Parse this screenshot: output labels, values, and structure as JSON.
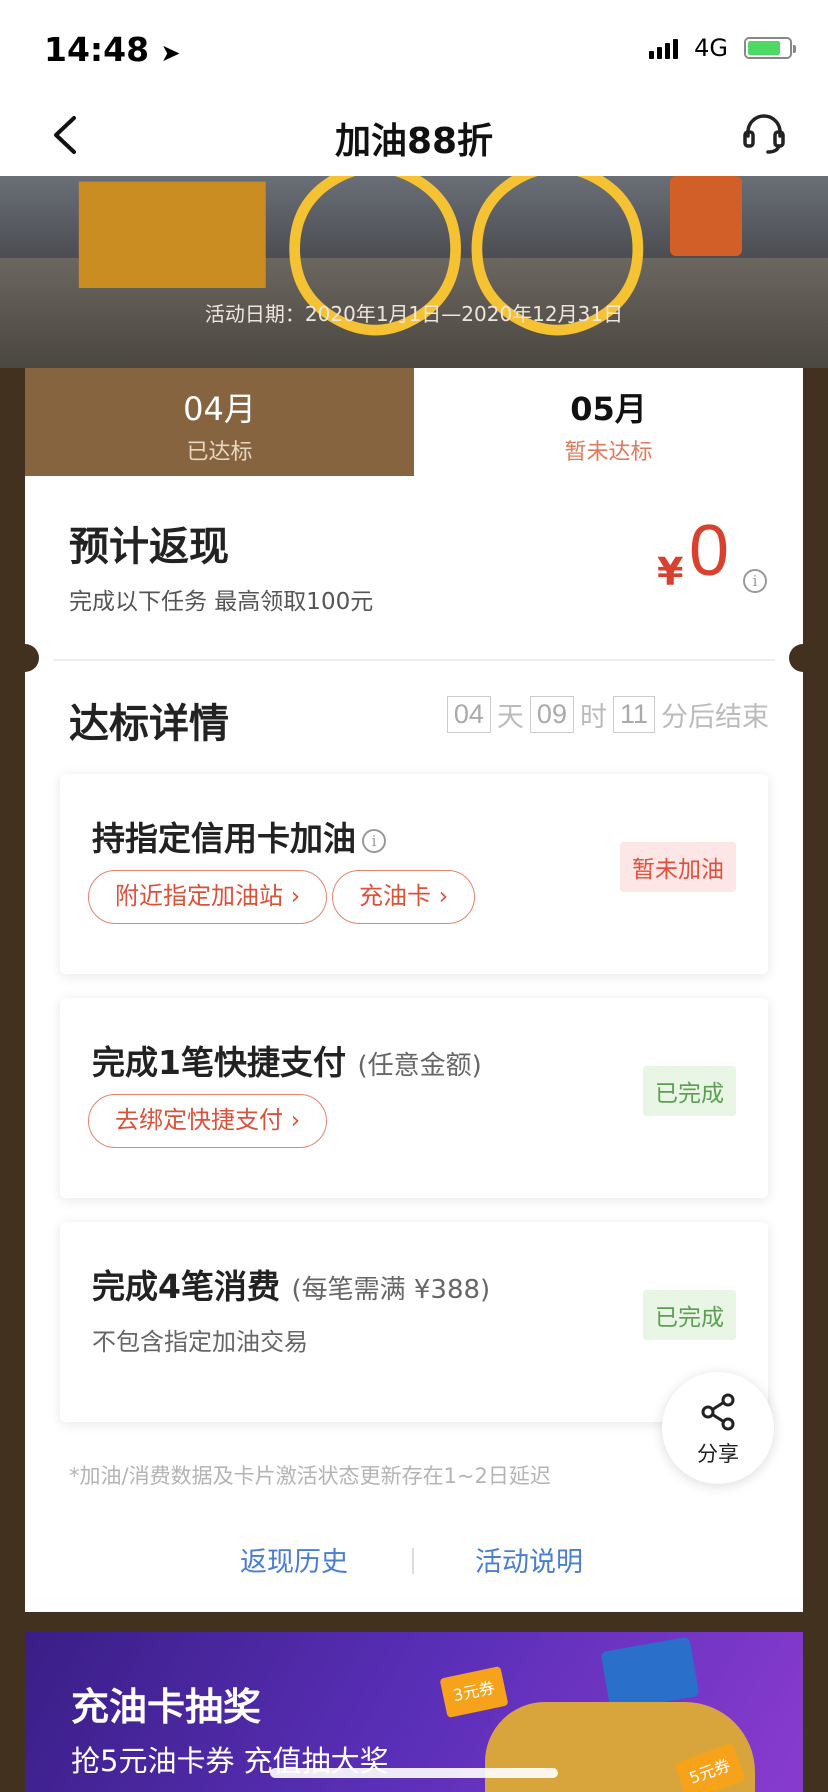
{
  "status_bar": {
    "time": "14:48",
    "network": "4G"
  },
  "nav": {
    "title": "加油88折"
  },
  "banner": {
    "date_text": "活动日期：2020年1月1日—2020年12月31日"
  },
  "tabs": [
    {
      "month": "04月",
      "status": "已达标"
    },
    {
      "month": "05月",
      "status": "暂未达标"
    }
  ],
  "cashback": {
    "title": "预计返现",
    "subtitle": "完成以下任务 最高领取100元",
    "currency": "¥",
    "amount": "0"
  },
  "details": {
    "title": "达标详情",
    "countdown": {
      "days": "04",
      "day_unit": "天",
      "hours": "09",
      "hour_unit": "时",
      "minutes": "11",
      "suffix": "分后结束"
    }
  },
  "tasks": [
    {
      "title": "持指定信用卡加油",
      "buttons": [
        "附近指定加油站 ›",
        "充油卡 ›"
      ],
      "status": "暂未加油"
    },
    {
      "title": "完成1笔快捷支付",
      "note": "(任意金额)",
      "buttons": [
        "去绑定快捷支付 ›"
      ],
      "status": "已完成"
    },
    {
      "title": "完成4笔消费",
      "note": "(每笔需满 ¥388)",
      "desc": "不包含指定加油交易",
      "status": "已完成"
    }
  ],
  "footnote": "*加油/消费数据及卡片激活状态更新存在1~2日延迟",
  "links": {
    "history": "返现历史",
    "rules": "活动说明"
  },
  "share": {
    "label": "分享"
  },
  "lottery": {
    "title": "充油卡抽奖",
    "subtitle": "抢5元油卡券 充值抽大奖",
    "coupon_a": "3元券",
    "coupon_b": "5元券"
  },
  "colors": {
    "accent_red": "#d8412f",
    "tab_brown": "#86643f",
    "link_blue": "#4a7fd0",
    "success_green": "#5aa050"
  }
}
